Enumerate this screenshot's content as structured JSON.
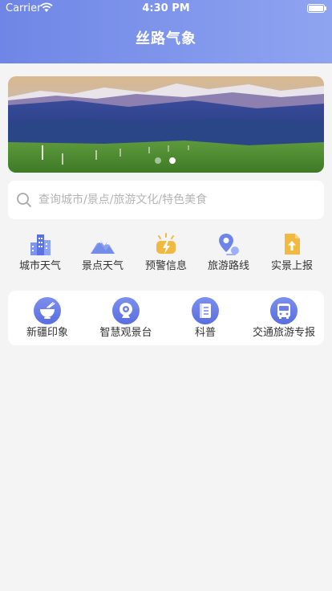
{
  "status_bar": {
    "carrier": "Carrier",
    "time": "4:30 PM"
  },
  "header": {
    "title": "丝路气象"
  },
  "banner": {
    "page_count": 2,
    "active_page": 2
  },
  "search": {
    "placeholder": "查询城市/景点/旅游文化/特色美食"
  },
  "quick_nav": [
    {
      "label": "城市天气",
      "icon": "city-buildings-icon"
    },
    {
      "label": "景点天气",
      "icon": "mountain-icon"
    },
    {
      "label": "预警信息",
      "icon": "warning-lightning-icon"
    },
    {
      "label": "旅游路线",
      "icon": "route-pin-icon"
    },
    {
      "label": "实景上报",
      "icon": "upload-report-icon"
    }
  ],
  "services": [
    {
      "label": "新疆印象",
      "icon": "bowl-icon"
    },
    {
      "label": "智慧观景台",
      "icon": "webcam-icon"
    },
    {
      "label": "科普",
      "icon": "book-icon"
    },
    {
      "label": "交通旅游专报",
      "icon": "bus-icon"
    }
  ],
  "colors": {
    "header_start": "#6f86e6",
    "header_end": "#8fa4f0",
    "accent": "#5a6ede",
    "background": "#f4f4f4"
  }
}
